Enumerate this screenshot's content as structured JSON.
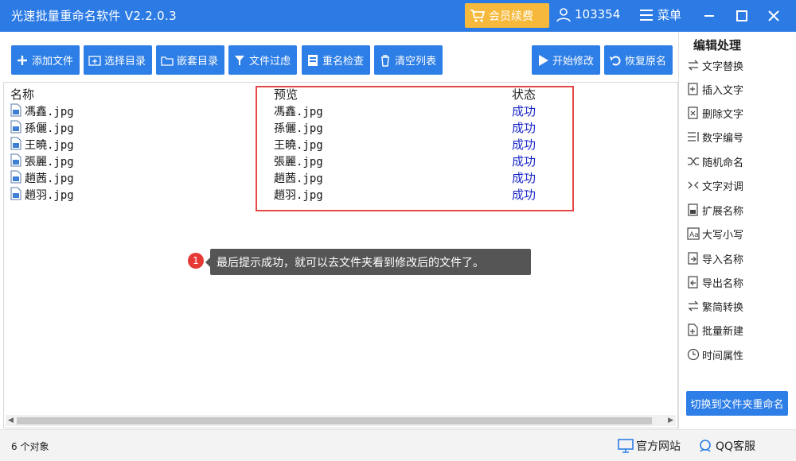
{
  "app": {
    "title": "光速批量重命名软件 V2.2.0.3"
  },
  "header": {
    "vip_label": "会员续费",
    "user_id": "103354",
    "menu_label": "菜单"
  },
  "toolbar": {
    "add_file": "添加文件",
    "select_dir": "选择目录",
    "nested_dir": "嵌套目录",
    "file_filter": "文件过虑",
    "rename_check": "重名检查",
    "clear_list": "清空列表",
    "start_modify": "开始修改",
    "restore_name": "恢复原名"
  },
  "list": {
    "columns": {
      "name": "名称",
      "preview": "预览",
      "status": "状态"
    },
    "rows": [
      {
        "name": "馮鑫.jpg",
        "preview": "馮鑫.jpg",
        "status": "成功"
      },
      {
        "name": "孫儷.jpg",
        "preview": "孫儷.jpg",
        "status": "成功"
      },
      {
        "name": "王曉.jpg",
        "preview": "王曉.jpg",
        "status": "成功"
      },
      {
        "name": "張麗.jpg",
        "preview": "張麗.jpg",
        "status": "成功"
      },
      {
        "name": "趙茜.jpg",
        "preview": "趙茜.jpg",
        "status": "成功"
      },
      {
        "name": "趙羽.jpg",
        "preview": "趙羽.jpg",
        "status": "成功"
      }
    ]
  },
  "tip": {
    "index": "1",
    "text": "最后提示成功，就可以去文件夹看到修改后的文件了。"
  },
  "sidebar": {
    "title": "编辑处理",
    "items": [
      "文字替换",
      "插入文字",
      "删除文字",
      "数字编号",
      "随机命名",
      "文字对调",
      "扩展名称",
      "大写小写",
      "导入名称",
      "导出名称",
      "繁简转换",
      "批量新建",
      "时间属性"
    ],
    "switch_button": "切换到文件夹重命名"
  },
  "statusbar": {
    "count": "6 个对象",
    "website": "官方网站",
    "qq": "QQ客服"
  },
  "colors": {
    "primary": "#2d7ee6",
    "title_bar": "#2c7be5",
    "vip": "#f6b93b",
    "success_text": "#1a27c7",
    "highlight_border": "#e54848"
  }
}
